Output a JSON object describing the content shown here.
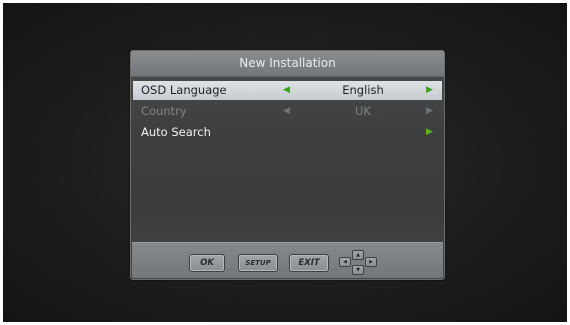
{
  "osd": {
    "title": "New Installation",
    "rows": [
      {
        "label": "OSD Language",
        "value": "English",
        "left_arrow": "◀",
        "right_arrow": "▶",
        "state": "selected"
      },
      {
        "label": "Country",
        "value": "UK",
        "left_arrow": "◀",
        "right_arrow": "▶",
        "state": "disabled"
      },
      {
        "label": "Auto Search",
        "value": "",
        "left_arrow": "",
        "right_arrow": "▶",
        "state": "normal"
      }
    ]
  },
  "footer": {
    "ok_label": "OK",
    "setup_label": "SETUP",
    "exit_label": "EXIT",
    "dpad": {
      "up": "▲",
      "down": "▼",
      "left": "◀",
      "right": "▶"
    }
  },
  "colors": {
    "accent_arrow": "#58b52a",
    "selected_row_bg": "#d6d9dc",
    "panel_bg": "#3e4041"
  }
}
